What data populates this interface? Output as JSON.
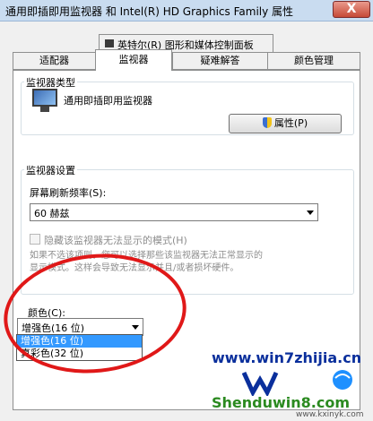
{
  "window": {
    "title": "通用即插即用监视器 和 Intel(R) HD Graphics Family 属性",
    "close_glyph": "X"
  },
  "tabs": {
    "top": "英特尔(R) 图形和媒体控制面板",
    "row": [
      {
        "label": "适配器"
      },
      {
        "label": "监视器",
        "active": true
      },
      {
        "label": "疑难解答"
      },
      {
        "label": "颜色管理"
      }
    ]
  },
  "monitor_type": {
    "group_label": "监视器类型",
    "name": "通用即插即用监视器",
    "properties_button": "属性(P)"
  },
  "monitor_settings": {
    "group_label": "监视器设置",
    "refresh_label": "屏幕刷新频率(S):",
    "refresh_value": "60 赫兹",
    "hide_modes_label": "隐藏该监视器无法显示的模式(H)",
    "hide_modes_checked": false,
    "help_line1": "如果不选该项则，您可以选择那些该监视器无法正常显示的",
    "help_line2": "显示模式。这样会导致无法显示并且/或者损坏硬件。"
  },
  "color": {
    "label": "颜色(C):",
    "selected": "增强色(16 位)",
    "options": [
      "增强色(16 位)",
      "真彩色(32 位)"
    ]
  },
  "watermark": {
    "site1": "www.win7zhijia.cn",
    "site2": "Shenduwin8.com",
    "site3": "www.kxinyk.com"
  },
  "colors": {
    "annotation": "#e01818",
    "selection": "#3399ff"
  },
  "icons": [
    "monitor-icon",
    "shield-icon",
    "intel-graphics-icon",
    "dropdown-arrow-icon"
  ]
}
